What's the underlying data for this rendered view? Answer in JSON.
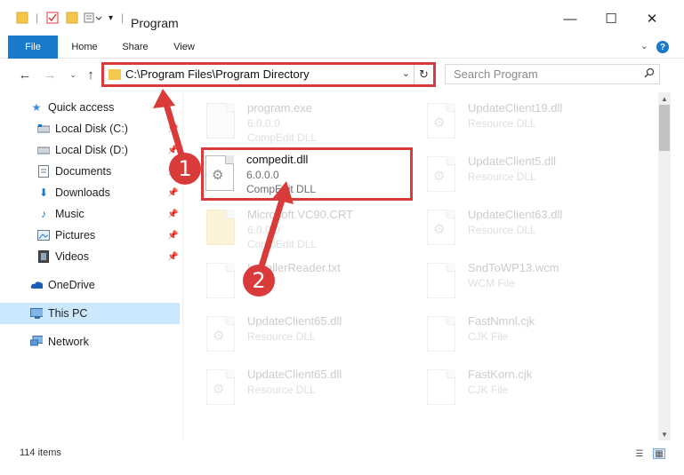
{
  "window": {
    "title": "Program",
    "minimize_glyph": "—",
    "maximize_glyph": "☐",
    "close_glyph": "✕"
  },
  "ribbon": {
    "tabs": [
      "File",
      "Home",
      "Share",
      "View"
    ],
    "help_glyph": "?"
  },
  "address_bar": {
    "path": "C:\\Program Files\\Program Directory",
    "refresh_glyph": "↻"
  },
  "search": {
    "placeholder": "Search Program"
  },
  "sidebar": {
    "items": [
      {
        "label": "Quick access",
        "icon": "star-icon"
      },
      {
        "label": "Local Disk (C:)",
        "icon": "drive-icon"
      },
      {
        "label": "Local Disk (D:)",
        "icon": "drive-icon"
      },
      {
        "label": "Documents",
        "icon": "documents-icon"
      },
      {
        "label": "Downloads",
        "icon": "downloads-icon"
      },
      {
        "label": "Music",
        "icon": "music-icon"
      },
      {
        "label": "Pictures",
        "icon": "pictures-icon"
      },
      {
        "label": "Videos",
        "icon": "videos-icon"
      },
      {
        "label": "OneDrive",
        "icon": "cloud-icon"
      },
      {
        "label": "This PC",
        "icon": "computer-icon"
      },
      {
        "label": "Network",
        "icon": "network-icon"
      }
    ]
  },
  "files": {
    "left": [
      {
        "name": "program.exe",
        "line2": "6.0.0.0",
        "line3": "CompEdit DLL"
      },
      {
        "name": "compedit.dll",
        "line2": "6.0.0.0",
        "line3": "CompEdit DLL"
      },
      {
        "name": "Microsoft.VC90.CRT",
        "line2": "6.0.0.0",
        "line3": "CompEdit DLL"
      },
      {
        "name": "InstallerReader.txt",
        "line2": "",
        "line3": ""
      },
      {
        "name": "UpdateClient65.dll",
        "line2": "Resource DLL",
        "line3": ""
      },
      {
        "name": "UpdateClient65.dll",
        "line2": "Resource DLL",
        "line3": ""
      }
    ],
    "right": [
      {
        "name": "UpdateClient19.dll",
        "line2": "Resource DLL"
      },
      {
        "name": "UpdateClient5.dll",
        "line2": "Resource DLL"
      },
      {
        "name": "UpdateClient63.dll",
        "line2": "Resource DLL"
      },
      {
        "name": "SndToWP13.wcm",
        "line2": "WCM File"
      },
      {
        "name": "FastNmnl.cjk",
        "line2": "CJK File"
      },
      {
        "name": "FastKorn.cjk",
        "line2": "CJK File"
      }
    ]
  },
  "status_bar": {
    "item_count": "114 items"
  },
  "annotations": {
    "step1": "1",
    "step2": "2",
    "color": "#d93a3a"
  },
  "colors": {
    "accent": "#1979ca",
    "selection": "#cce8ff",
    "annotation": "#d93a3a"
  }
}
